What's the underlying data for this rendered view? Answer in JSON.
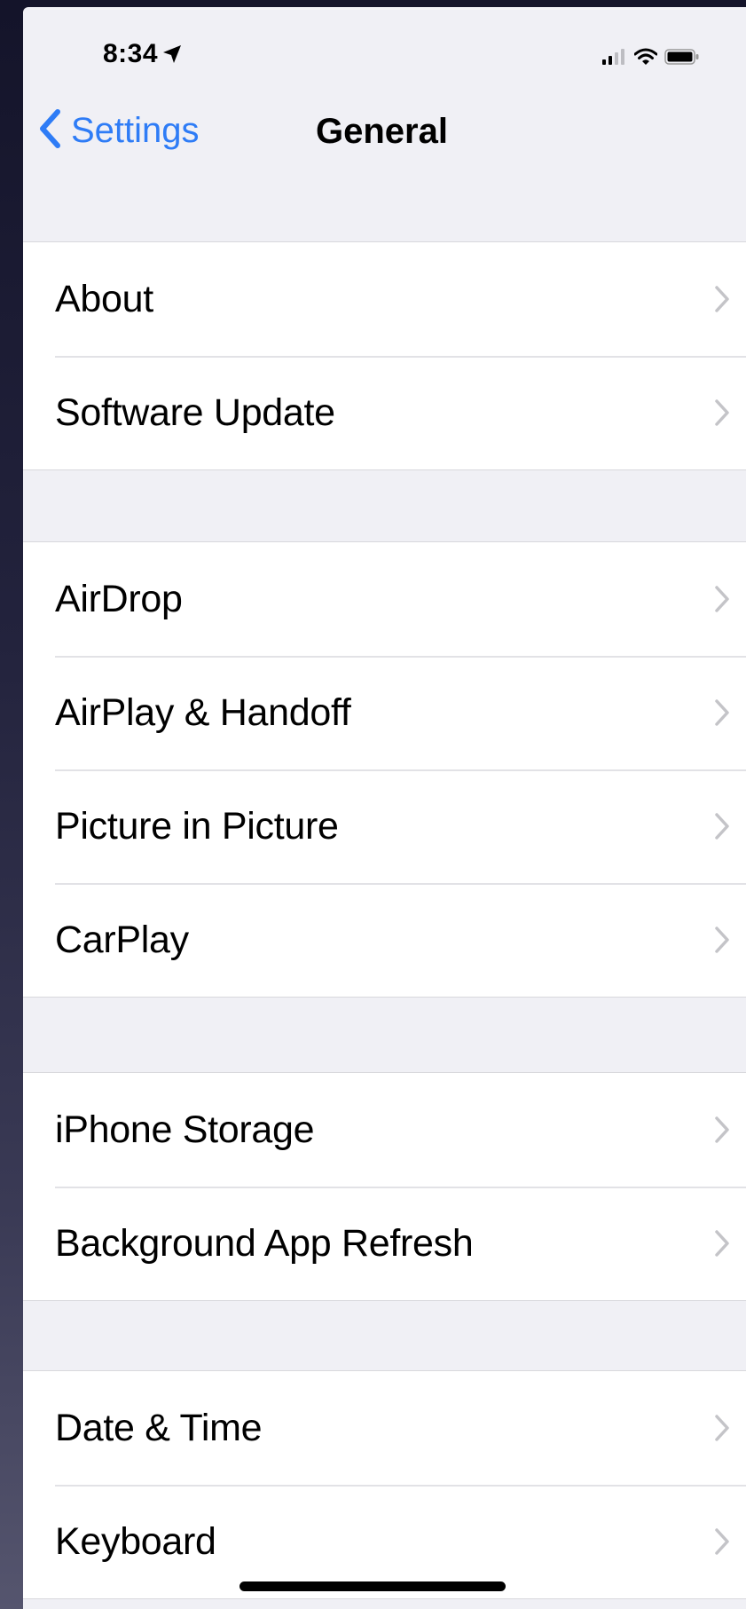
{
  "status_bar": {
    "time": "8:34",
    "location_icon": "location-arrow-icon",
    "signal_icon": "cellular-signal-icon",
    "wifi_icon": "wifi-icon",
    "battery_icon": "battery-icon"
  },
  "nav": {
    "back_label": "Settings",
    "back_icon": "chevron-left-icon",
    "title": "General"
  },
  "groups": [
    {
      "items": [
        {
          "label": "About"
        },
        {
          "label": "Software Update"
        }
      ]
    },
    {
      "items": [
        {
          "label": "AirDrop"
        },
        {
          "label": "AirPlay & Handoff"
        },
        {
          "label": "Picture in Picture"
        },
        {
          "label": "CarPlay"
        }
      ]
    },
    {
      "items": [
        {
          "label": "iPhone Storage"
        },
        {
          "label": "Background App Refresh"
        }
      ]
    },
    {
      "items": [
        {
          "label": "Date & Time"
        },
        {
          "label": "Keyboard"
        }
      ]
    }
  ],
  "colors": {
    "accent": "#2e7cf6",
    "background": "#f0f0f5",
    "cell": "#ffffff",
    "chevron": "#c4c4c8"
  }
}
